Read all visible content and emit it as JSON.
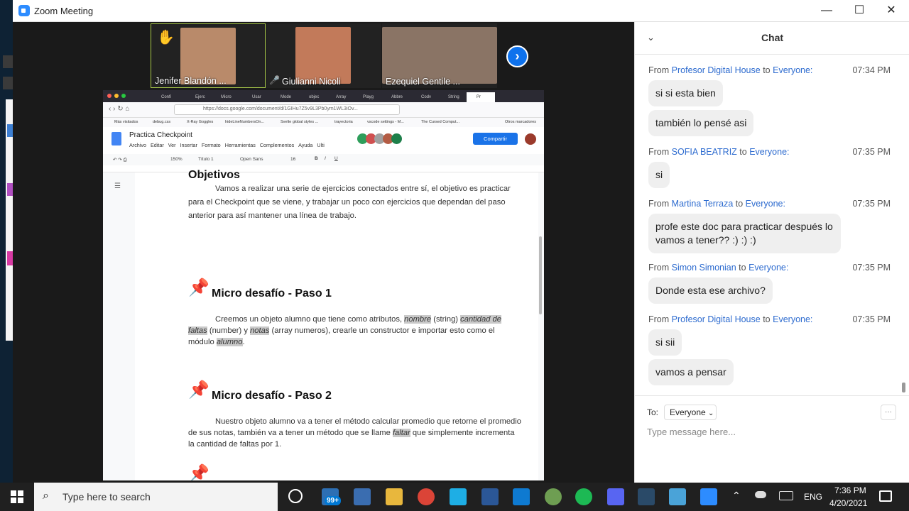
{
  "window": {
    "title": "Zoom Meeting",
    "minimize": "—",
    "maximize": "☐",
    "close": "✕"
  },
  "participants": [
    {
      "name": "Jenifer Blandón ...",
      "color": "#b98a6a"
    },
    {
      "name": "Giulianni Nicoli",
      "color": "#c27a5a"
    },
    {
      "name": "Ezequiel Gentile ...",
      "color": "#8a7465"
    }
  ],
  "browser": {
    "tabs": [
      "Confi",
      "Ejerc",
      "Micro",
      "Usar",
      "Mode",
      "objec",
      "Array",
      "Playg",
      "Abbre",
      "Codv",
      "String",
      "Pr"
    ],
    "url": "https://docs.google.com/document/d/1GIHu7Z5v9L3Pb0ym1WL3iOv...",
    "bookmarks": [
      "Más visitados",
      "debug.css",
      "X-Ray Goggles",
      "hideLineNumbersOn...",
      "Svelte global styles ...",
      "trayectoria",
      "vscode settings - M...",
      "The Cursed Comput...",
      "Otros marcadores"
    ]
  },
  "docs": {
    "title": "Practica Checkpoint",
    "menu": [
      "Archivo",
      "Editar",
      "Ver",
      "Insertar",
      "Formato",
      "Herramientas",
      "Complementos",
      "Ayuda",
      "Ulti"
    ],
    "share": "Compartir",
    "toolbar": {
      "zoom": "150%",
      "style": "Título 1",
      "font": "Open Sans",
      "size": "16"
    },
    "heading": "Objetivos",
    "intro": "Vamos a realizar una serie de ejercicios conectados entre sí, el objetivo es practicar para el Checkpoint que se viene, y trabajar un poco con ejercicios que dependan del paso anterior para así mantener una línea de trabajo.",
    "step1_title": "Micro desafío - Paso 1",
    "step1_a": "Creemos un objeto alumno que tiene como atributos, ",
    "step1_nombre": "nombre",
    "step1_b": " (string) ",
    "step1_faltas": "cantidad de faltas",
    "step1_c": " (number) y ",
    "step1_notas": "notas",
    "step1_d": " (array numeros), crearle un constructor e importar esto como el módulo ",
    "step1_alumno": "alumno",
    "step1_e": ".",
    "step2_title": "Micro desafío - Paso 2",
    "step2_a": "Nuestro objeto alumno va a tener el método calcular promedio que retorne el promedio de sus notas, también va a tener un método que se llame ",
    "step2_faltar": "faltar",
    "step2_b": " que simplemente incrementa la cantidad de faltas por 1."
  },
  "chat": {
    "header": "Chat",
    "messages": [
      {
        "from": "Profesor Digital House",
        "to": "Everyone:",
        "time": "07:34 PM",
        "bubbles": [
          "si si esta bien",
          "también lo pensé asi"
        ]
      },
      {
        "from": "SOFIA BEATRIZ",
        "to": "Everyone:",
        "time": "07:35 PM",
        "bubbles": [
          "si"
        ]
      },
      {
        "from": "Martina Terraza",
        "to": "Everyone:",
        "time": "07:35 PM",
        "bubbles": [
          "profe este doc para practicar después lo vamos a tener?? :) :) :)"
        ]
      },
      {
        "from": "Simon Simonian",
        "to": "Everyone:",
        "time": "07:35 PM",
        "bubbles": [
          "Donde esta ese archivo?"
        ]
      },
      {
        "from": "Profesor Digital House",
        "to": "Everyone:",
        "time": "07:35 PM",
        "bubbles": [
          "si sii",
          "vamos a pensar"
        ]
      }
    ],
    "from_word": "From",
    "to_word": "to",
    "to_label": "To:",
    "recipient": "Everyone",
    "placeholder": "Type message here...",
    "more": "···"
  },
  "taskbar": {
    "search": "Type here to search",
    "badge": "99+",
    "lang": "ENG",
    "time": "7:36 PM",
    "date": "4/20/2021"
  }
}
